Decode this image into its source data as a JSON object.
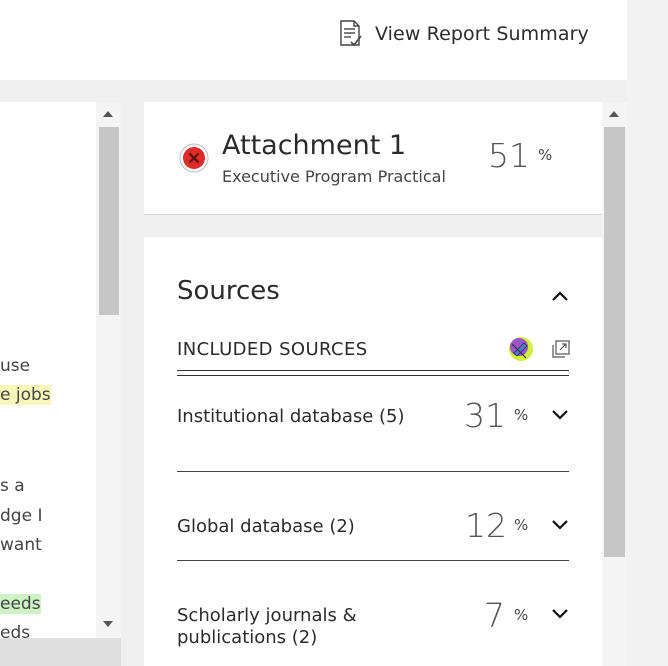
{
  "header": {
    "report_summary_label": "View Report Summary",
    "report_icon": "report-checklist-icon"
  },
  "document": {
    "lines": [
      {
        "text": "use",
        "highlight": "none"
      },
      {
        "text": "e jobs",
        "highlight": "yellow"
      },
      {
        "text": "s a",
        "highlight": "none"
      },
      {
        "text": "dge I",
        "highlight": "none"
      },
      {
        "text": "want",
        "highlight": "none"
      },
      {
        "text": "eeds",
        "highlight": "green"
      },
      {
        "text": "eds",
        "highlight": "none"
      }
    ]
  },
  "attachment": {
    "title": "Attachment 1",
    "subtitle": "Executive Program Practical ...",
    "percent": "51",
    "percent_sign": "%",
    "status_icon": "error-icon",
    "status_color": "#e02b2b"
  },
  "sources": {
    "title": "Sources",
    "included_label": "INCLUDED SOURCES",
    "items": [
      {
        "label": "Institutional database (5)",
        "percent": "31",
        "percent_sign": "%"
      },
      {
        "label": "Global database (2)",
        "percent": "12",
        "percent_sign": "%"
      },
      {
        "label": "Scholarly journals & publications (2)",
        "percent": "7",
        "percent_sign": "%"
      }
    ]
  },
  "colors": {
    "yellow_highlight": "#f6f7b8",
    "green_highlight": "#cdf2c4"
  }
}
